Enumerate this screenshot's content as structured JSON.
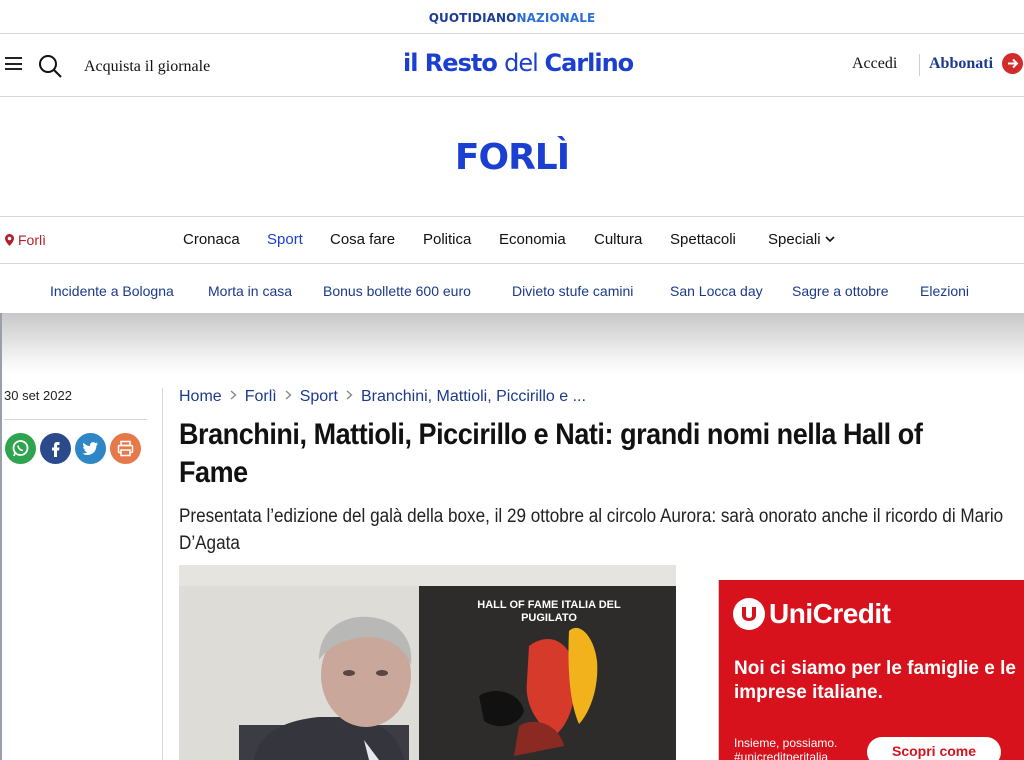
{
  "network": {
    "part1": "QUOTIDIANO",
    "part2": "NAZIONALE"
  },
  "header": {
    "buy_label": "Acquista il giornale",
    "brand_part1": "il Resto ",
    "brand_part2": "del ",
    "brand_part3": "Carlino",
    "login_label": "Accedi",
    "subscribe_label": "Abbonati"
  },
  "section": {
    "title": "FORLÌ"
  },
  "nav": {
    "location": "Forlì",
    "items": [
      "Cronaca",
      "Sport",
      "Cosa fare",
      "Politica",
      "Economia",
      "Cultura",
      "Spettacoli",
      "Speciali"
    ],
    "active": "Sport"
  },
  "trending": [
    "Incidente a Bologna",
    "Morta in casa",
    "Bonus bollette 600 euro",
    "Divieto stufe camini",
    "San Locca day",
    "Sagre a ottobre",
    "Elezioni"
  ],
  "article": {
    "date": "30 set 2022",
    "breadcrumb": [
      "Home",
      "Forlì",
      "Sport",
      "Branchini, Mattioli, Piccirillo e ..."
    ],
    "headline": "Branchini, Mattioli, Piccirillo e Nati: grandi nomi nella Hall of Fame",
    "subtitle": "Presentata l’edizione del galà della boxe, il 29 ottobre al circolo Aurora: sarà onorato anche il ricordo di Mario D’Agata",
    "image_poster_text": "HALL OF FAME ITALIA DEL PUGILATO"
  },
  "share": {
    "icons": [
      "whatsapp-icon",
      "facebook-icon",
      "twitter-icon",
      "print-icon"
    ],
    "colors": [
      "#2fa44f",
      "#2b4a8b",
      "#2f86c7",
      "#e5794a"
    ]
  },
  "ad": {
    "brand": "UniCredit",
    "headline": "Noi ci siamo per le famiglie e le imprese italiane.",
    "small_text": "Insieme, possiamo. #unicreditperitalia",
    "cta": "Scopri come",
    "color": "#d7121d"
  },
  "colors": {
    "brand_blue": "#1b3fd0",
    "link_blue": "#1b3a8c",
    "location_red": "#b3202a"
  }
}
